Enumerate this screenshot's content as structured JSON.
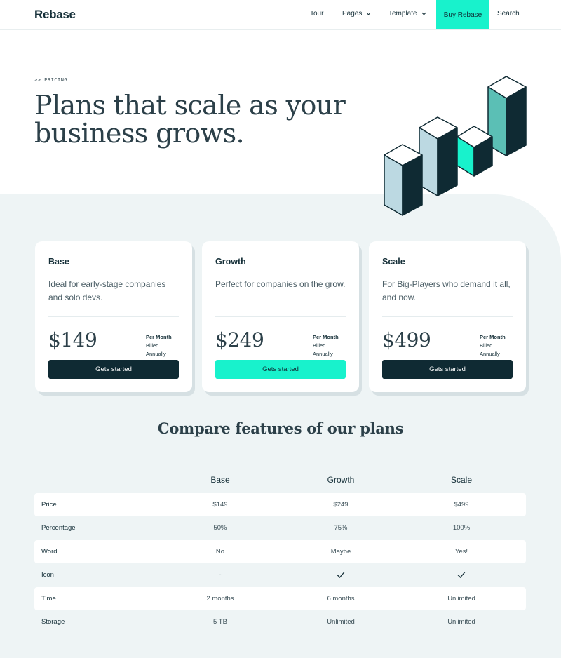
{
  "nav": {
    "logo": "Rebase",
    "items": [
      {
        "label": "Tour"
      },
      {
        "label": "Pages"
      },
      {
        "label": "Template"
      }
    ],
    "buy_label": "Buy Rebase",
    "search_label": "Search",
    "accent_color": "#18f2cc"
  },
  "hero": {
    "eyebrow": ">> PRICING",
    "title": "Plans that scale as your business grows."
  },
  "plans": [
    {
      "name": "Base",
      "description": "Ideal for early-stage companies and solo devs.",
      "price": "$149",
      "period": "Per Month",
      "billing": "Billed Annually",
      "cta": "Gets started"
    },
    {
      "name": "Growth",
      "description": "Perfect for companies on the grow.",
      "price": "$249",
      "period": "Per Month",
      "billing": "Billed Annually",
      "cta": "Gets started"
    },
    {
      "name": "Scale",
      "description": "For Big-Players who demand it all, and now.",
      "price": "$499",
      "period": "Per Month",
      "billing": "Billed Annually",
      "cta": "Gets started"
    }
  ],
  "compare": {
    "title": "Compare features of our plans",
    "columns": [
      "Base",
      "Growth",
      "Scale"
    ],
    "rows": [
      {
        "label": "Price",
        "values": [
          "$149",
          "$249",
          "$499"
        ]
      },
      {
        "label": "Percentage",
        "values": [
          "50%",
          "75%",
          "100%"
        ]
      },
      {
        "label": "Word",
        "values": [
          "No",
          "Maybe",
          "Yes!"
        ]
      },
      {
        "label": "Icon",
        "values": [
          "-",
          "check-icon",
          "check-icon"
        ]
      },
      {
        "label": "Time",
        "values": [
          "2 months",
          "6 months",
          "Unlimited"
        ]
      },
      {
        "label": "Storage",
        "values": [
          "5 TB",
          "Unlimited",
          "Unlimited"
        ]
      }
    ]
  }
}
